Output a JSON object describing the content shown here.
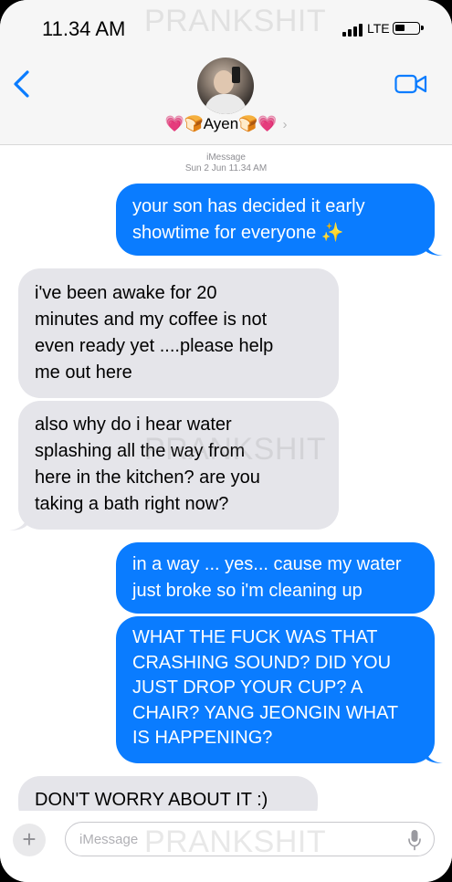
{
  "status_bar": {
    "time": "11.34 AM",
    "network": "LTE",
    "watermark": "PRANKSHIT"
  },
  "header": {
    "contact_name": "💗🍞Ayen🍞💗",
    "chevron": "›",
    "icons": {
      "back": "chevron-left-icon",
      "video": "video-camera-icon",
      "avatar": "contact-avatar"
    }
  },
  "conversation": {
    "service": "iMessage",
    "timestamp": "Sun 2 Jun 11.34 AM",
    "watermark": "PRANKSHIT",
    "messages": [
      {
        "direction": "sent",
        "lines": [
          "your son has decided it early",
          "showtime for everyone ✨"
        ]
      },
      {
        "direction": "received",
        "lines": [
          "i've been awake for 20",
          "minutes and my coffee is not",
          "even ready yet ....please help",
          "me out here"
        ]
      },
      {
        "direction": "received",
        "lines": [
          "also why do i hear water",
          "splashing all the way from",
          "here in the kitchen? are you",
          "taking a bath right now?"
        ]
      },
      {
        "direction": "sent",
        "lines": [
          "in a way ... yes... cause my water",
          "just broke so i'm cleaning up"
        ]
      },
      {
        "direction": "sent",
        "lines": [
          "WHAT THE FUCK WAS THAT",
          "CRASHING SOUND? DID YOU",
          "JUST DROP YOUR CUP? A",
          "CHAIR? YANG JEONGIN WHAT",
          "IS HAPPENING?"
        ]
      },
      {
        "direction": "received",
        "lines": [
          "DON'T WORRY ABOUT IT :)"
        ]
      }
    ]
  },
  "input_bar": {
    "placeholder": "iMessage",
    "watermark": "PRANKSHIT",
    "icons": {
      "add": "plus-icon",
      "mic": "microphone-icon"
    }
  },
  "colors": {
    "sent_bubble": "#0a7cff",
    "received_bubble": "#e5e5ea",
    "accent": "#0a7cff",
    "header_bg": "#f6f6f6"
  }
}
